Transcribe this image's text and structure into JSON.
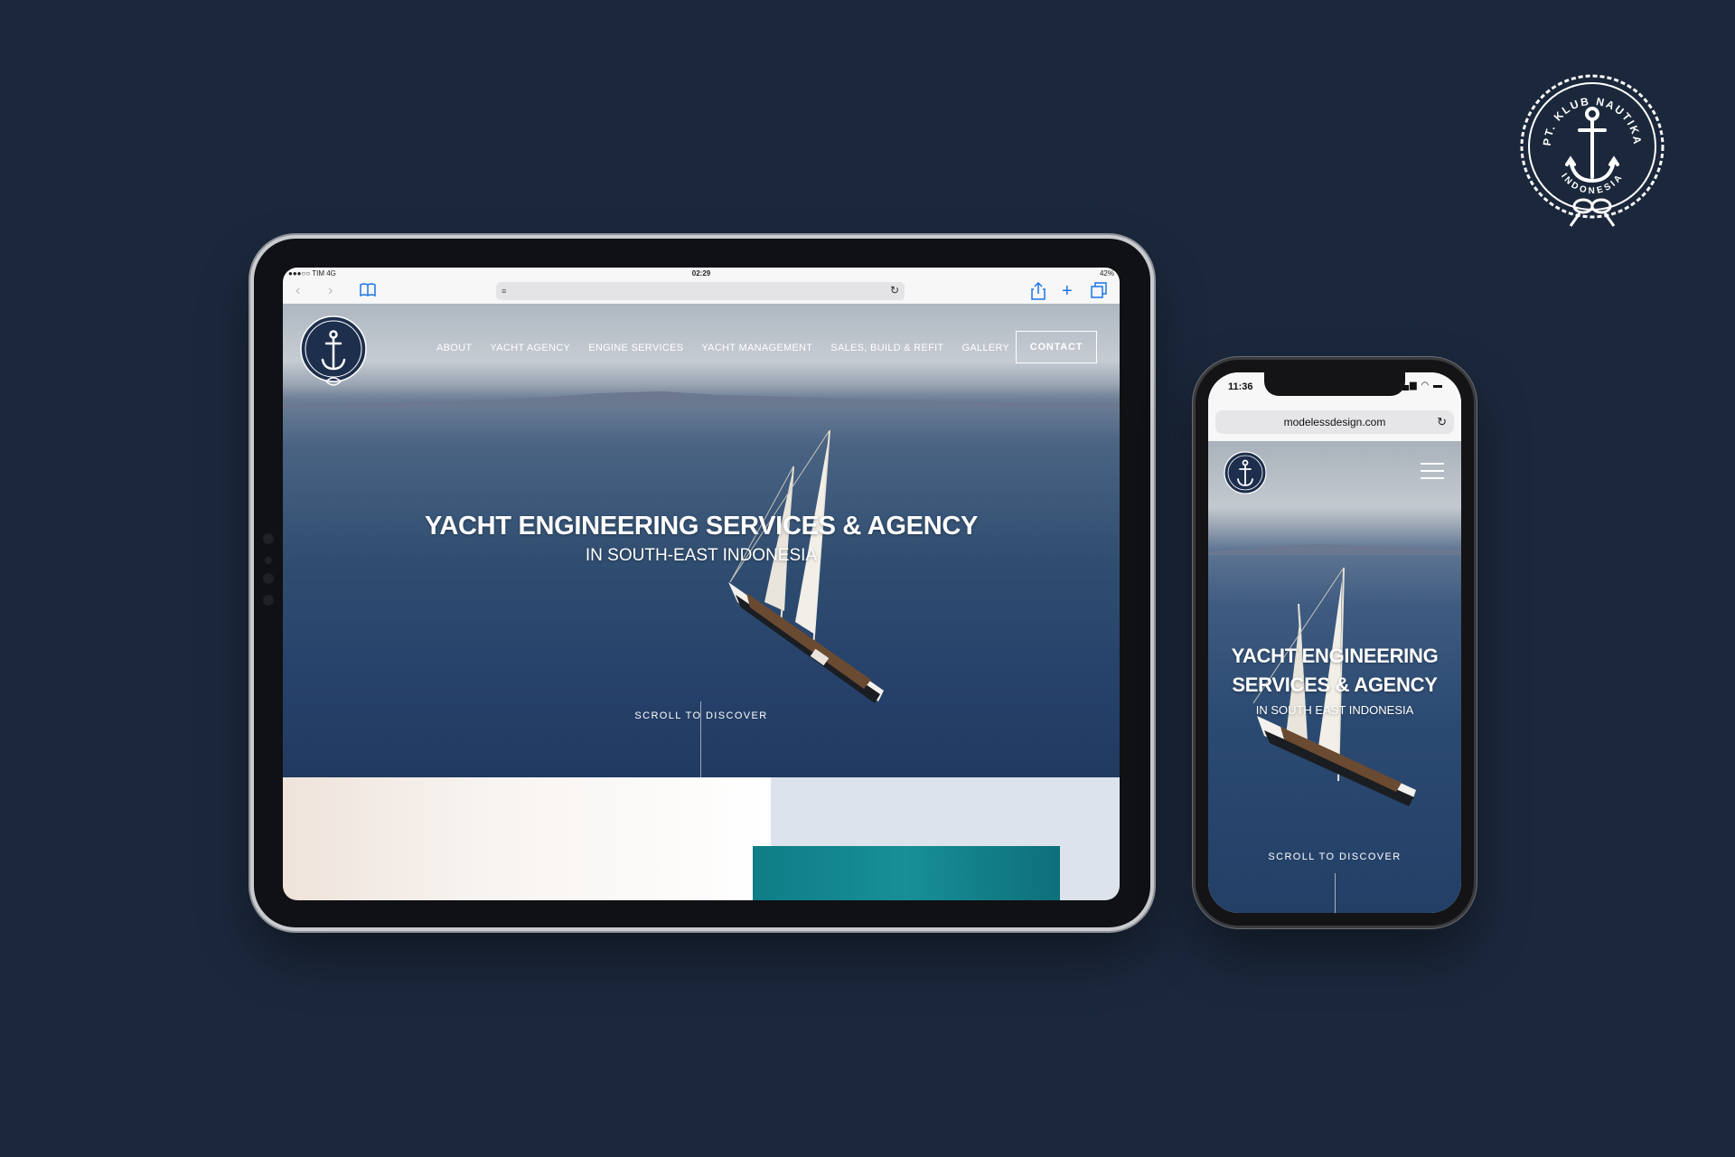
{
  "brand": {
    "badge_text_top": "PT. KLUB NAUTIKA",
    "badge_text_bottom": "INDONESIA"
  },
  "tablet": {
    "status_bar": {
      "carrier": "●●●○○ TIM  4G",
      "time": "02:29",
      "battery": "42%"
    },
    "toolbar": {
      "icons": [
        "back-icon",
        "forward-icon",
        "bookmarks-icon",
        "reader-icon",
        "reload-icon",
        "share-icon",
        "new-tab-icon",
        "tabs-icon"
      ]
    },
    "site": {
      "nav": [
        "ABOUT",
        "YACHT AGENCY",
        "ENGINE SERVICES",
        "YACHT MANAGEMENT",
        "SALES, BUILD & REFIT",
        "GALLERY"
      ],
      "contact_label": "CONTACT",
      "headline": "YACHT ENGINEERING SERVICES & AGENCY",
      "subheadline": "IN SOUTH-EAST INDONESIA",
      "scroll_label": "SCROLL TO DISCOVER"
    }
  },
  "phone": {
    "status_bar": {
      "time": "11:36"
    },
    "url": "modelessdesign.com",
    "site": {
      "headline_line1": "YACHT ENGINEERING",
      "headline_line2": "SERVICES & AGENCY",
      "subheadline": "IN SOUTH EAST INDONESIA",
      "scroll_label": "SCROLL TO DISCOVER"
    }
  },
  "colors": {
    "background": "#1b283c",
    "safari_blue": "#1a73e8",
    "teal_block": "#137f88"
  }
}
